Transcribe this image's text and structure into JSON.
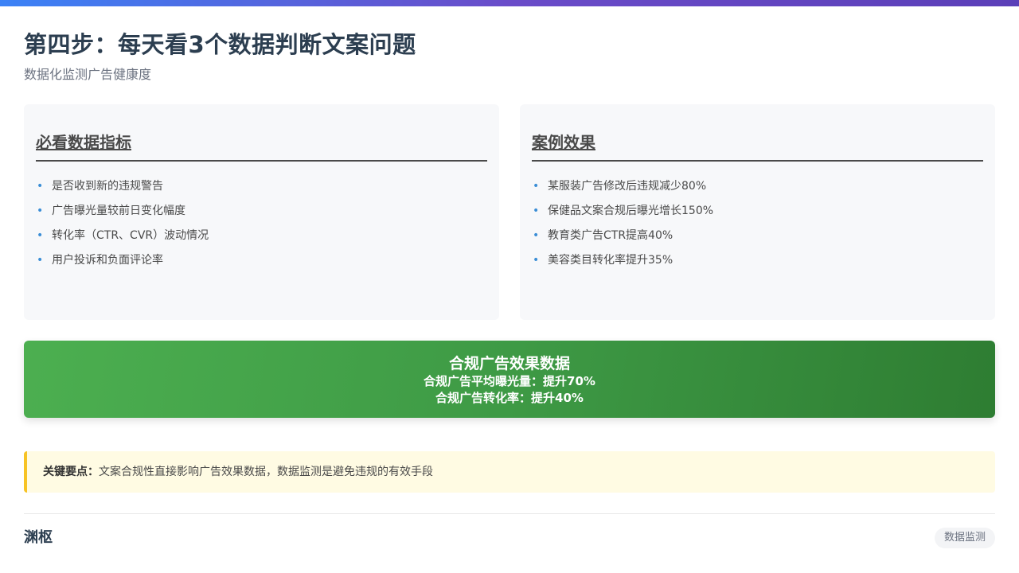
{
  "header": {
    "title": "第四步：每天看3个数据判断文案问题",
    "subtitle": "数据化监测广告健康度"
  },
  "cards": {
    "metrics": {
      "title": "必看数据指标",
      "items": [
        "是否收到新的违规警告",
        "广告曝光量较前日变化幅度",
        "转化率（CTR、CVR）波动情况",
        "用户投诉和负面评论率"
      ]
    },
    "cases": {
      "title": "案例效果",
      "items": [
        "某服装广告修改后违规减少80%",
        "保健品文案合规后曝光增长150%",
        "教育类广告CTR提高40%",
        "美容类目转化率提升35%"
      ]
    }
  },
  "banner": {
    "title": "合规广告效果数据",
    "line1": "合规广告平均曝光量：提升70%",
    "line2": "合规广告转化率：提升40%"
  },
  "keypoint": {
    "label": "关键要点：",
    "text": "文案合规性直接影响广告效果数据，数据监测是避免违规的有效手段"
  },
  "footer": {
    "brand": "渊枢",
    "tag": "数据监测"
  },
  "colors": {
    "accent_blue": "#3b8ed6",
    "banner_green_start": "#4caf50",
    "banner_green_end": "#2e7d32",
    "keypoint_border": "#f7c325",
    "title_text": "#2c3e50"
  },
  "icons": {
    "bullet": "•"
  }
}
